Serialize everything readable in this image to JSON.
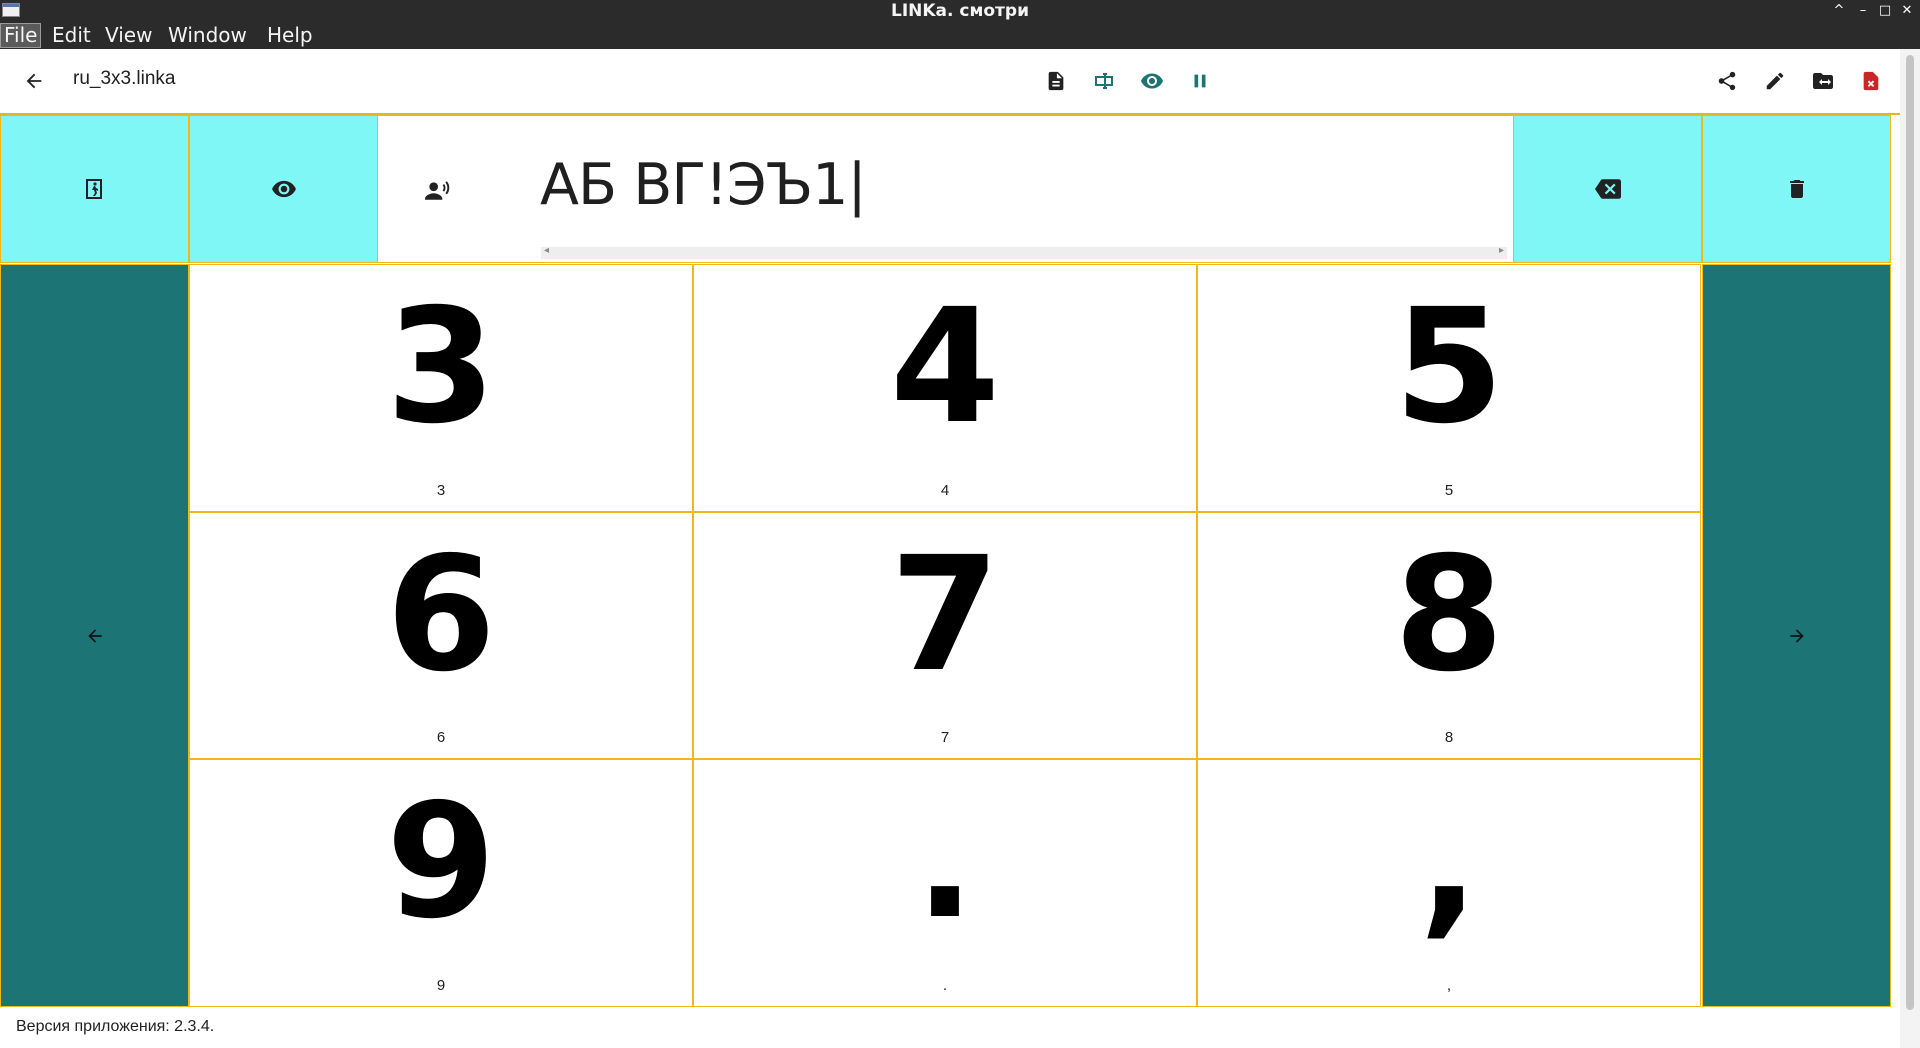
{
  "window": {
    "title": "LINKa. смотри",
    "controls": [
      "^",
      "–",
      "□",
      "✕"
    ]
  },
  "menu": {
    "items": [
      "File",
      "Edit",
      "View",
      "Window",
      "Help"
    ],
    "active": "File"
  },
  "appbar": {
    "filename": "ru_3x3.linka",
    "left_icon": "arrow-back-icon",
    "center_icons": [
      "document-icon",
      "text-cursor-icon",
      "eye-icon",
      "pause-icon"
    ],
    "right_icons": [
      "share-icon",
      "pencil-icon",
      "folder-swap-icon",
      "delete-file-icon"
    ]
  },
  "toolbar": {
    "exit_icon": "exit-run-icon",
    "view_icon": "eye-icon",
    "speak_icon": "speaker-person-icon",
    "backspace_icon": "backspace-icon",
    "clear_icon": "trash-icon"
  },
  "input": {
    "text": "АБ ВГ!ЭЪ1|"
  },
  "grid": {
    "cells": [
      {
        "symbol": "3",
        "label": "3"
      },
      {
        "symbol": "4",
        "label": "4"
      },
      {
        "symbol": "5",
        "label": "5"
      },
      {
        "symbol": "6",
        "label": "6"
      },
      {
        "symbol": "7",
        "label": "7"
      },
      {
        "symbol": "8",
        "label": "8"
      },
      {
        "symbol": "9",
        "label": "9"
      },
      {
        "symbol": ".",
        "label": "."
      },
      {
        "symbol": ",",
        "label": ","
      }
    ]
  },
  "status": {
    "version_text": "Версия приложения: 2.3.4."
  },
  "colors": {
    "accent_light": "#80f7f7",
    "accent_dark": "#1c7474",
    "border": "#f0b81c",
    "chrome": "#2b2b2b",
    "teal_icon": "#1c7474",
    "danger": "#c62828"
  }
}
